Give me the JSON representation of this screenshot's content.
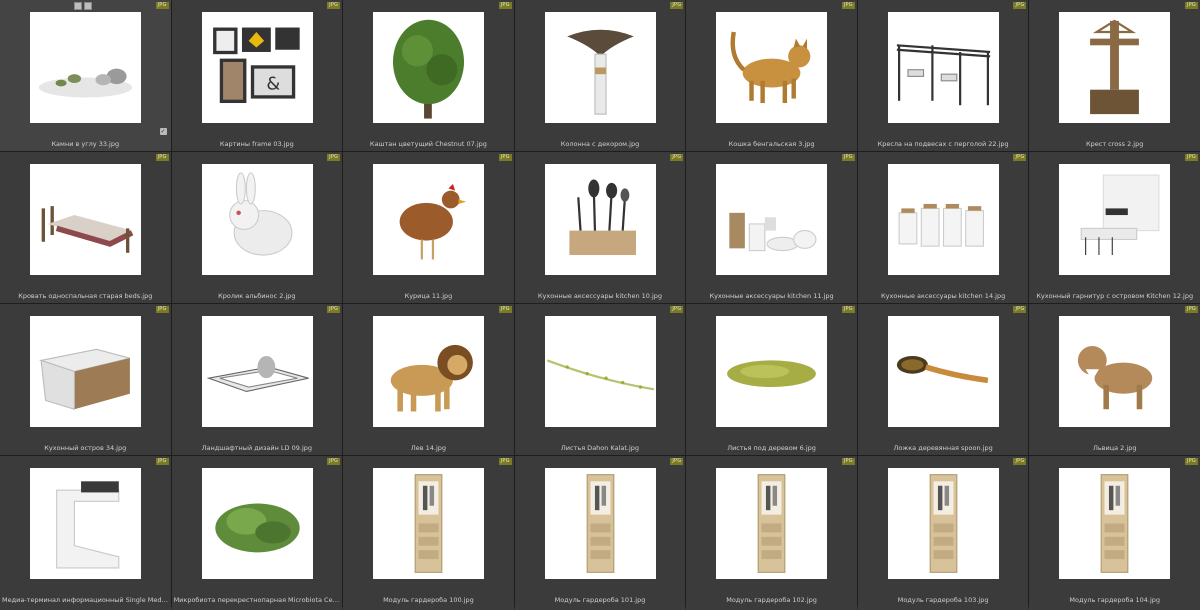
{
  "badge_text": "JPG",
  "items": [
    {
      "label": "Камни в углу 33.jpg",
      "icon": "rocks-garden-icon"
    },
    {
      "label": "Картины frame 03.jpg",
      "icon": "picture-frames-icon"
    },
    {
      "label": "Каштан цветущий Chestnut 07.jpg",
      "icon": "tree-icon"
    },
    {
      "label": "Колонна с декором.jpg",
      "icon": "column-icon"
    },
    {
      "label": "Кошка бенгальская 3.jpg",
      "icon": "cat-icon"
    },
    {
      "label": "Кресла на подвесах с перголой 22.jpg",
      "icon": "pergola-swings-icon"
    },
    {
      "label": "Крест cross 2.jpg",
      "icon": "cross-icon"
    },
    {
      "label": "Кровать односпальная старая beds.jpg",
      "icon": "bed-icon"
    },
    {
      "label": "Кролик альбинос 2.jpg",
      "icon": "rabbit-icon"
    },
    {
      "label": "Курица 11.jpg",
      "icon": "chicken-icon"
    },
    {
      "label": "Кухонные аксессуары kitchen 10.jpg",
      "icon": "kitchen-utensils-icon"
    },
    {
      "label": "Кухонные аксессуары kitchen 11.jpg",
      "icon": "kitchen-accessories-icon"
    },
    {
      "label": "Кухонные аксессуары kitchen 14.jpg",
      "icon": "kitchen-jars-icon"
    },
    {
      "label": "Кухонный гарнитур с островом Kitchen 12.jpg",
      "icon": "kitchen-set-icon"
    },
    {
      "label": "Кухонный остров 34.jpg",
      "icon": "kitchen-island-icon"
    },
    {
      "label": "Ландшафтный дизайн LD 09.jpg",
      "icon": "landscape-design-icon"
    },
    {
      "label": "Лев 14.jpg",
      "icon": "lion-icon"
    },
    {
      "label": "Листья Dahon Kalat.jpg",
      "icon": "leaves-line-icon"
    },
    {
      "label": "Листья под деревом 6.jpg",
      "icon": "leaves-pile-icon"
    },
    {
      "label": "Ложка деревянная spoon.jpg",
      "icon": "spoon-icon"
    },
    {
      "label": "Львица 2.jpg",
      "icon": "lioness-icon"
    },
    {
      "label": "Медиа-терминал информационный Single Media Unit.jpg",
      "icon": "media-terminal-icon"
    },
    {
      "label": "Микробиота перекрестнопарная Microbiota Celtic Pride.jpg",
      "icon": "shrub-icon"
    },
    {
      "label": "Модуль гардероба 100.jpg",
      "icon": "wardrobe-icon"
    },
    {
      "label": "Модуль гардероба 101.jpg",
      "icon": "wardrobe-icon"
    },
    {
      "label": "Модуль гардероба 102.jpg",
      "icon": "wardrobe-icon"
    },
    {
      "label": "Модуль гардероба 103.jpg",
      "icon": "wardrobe-icon"
    },
    {
      "label": "Модуль гардероба 104.jpg",
      "icon": "wardrobe-icon"
    }
  ]
}
